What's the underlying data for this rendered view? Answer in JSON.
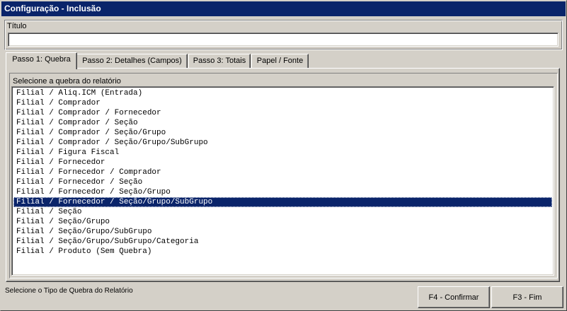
{
  "window": {
    "title": "Configuração - Inclusão"
  },
  "titulo": {
    "label": "Título",
    "value": ""
  },
  "tabs": [
    {
      "label": "Passo 1: Quebra",
      "active": true
    },
    {
      "label": "Passo 2: Detalhes (Campos)",
      "active": false
    },
    {
      "label": "Passo 3: Totais",
      "active": false
    },
    {
      "label": "Papel / Fonte",
      "active": false
    }
  ],
  "quebra": {
    "label": "Selecione a quebra do relatório",
    "selected_index": 11,
    "items": [
      "Filial / Aliq.ICM (Entrada)",
      "Filial / Comprador",
      "Filial / Comprador / Fornecedor",
      "Filial / Comprador / Seção",
      "Filial / Comprador / Seção/Grupo",
      "Filial / Comprador / Seção/Grupo/SubGrupo",
      "Filial / Figura Fiscal",
      "Filial / Fornecedor",
      "Filial / Fornecedor / Comprador",
      "Filial / Fornecedor / Seção",
      "Filial / Fornecedor / Seção/Grupo",
      "Filial / Fornecedor / Seção/Grupo/SubGrupo",
      "Filial / Seção",
      "Filial / Seção/Grupo",
      "Filial / Seção/Grupo/SubGrupo",
      "Filial / Seção/Grupo/SubGrupo/Categoria",
      "Filial / Produto (Sem Quebra)"
    ]
  },
  "status": {
    "text": "Selecione o Tipo de Quebra do Relatório"
  },
  "buttons": {
    "confirm_label": "F4 - Confirmar",
    "end_label": "F3 - Fim"
  }
}
